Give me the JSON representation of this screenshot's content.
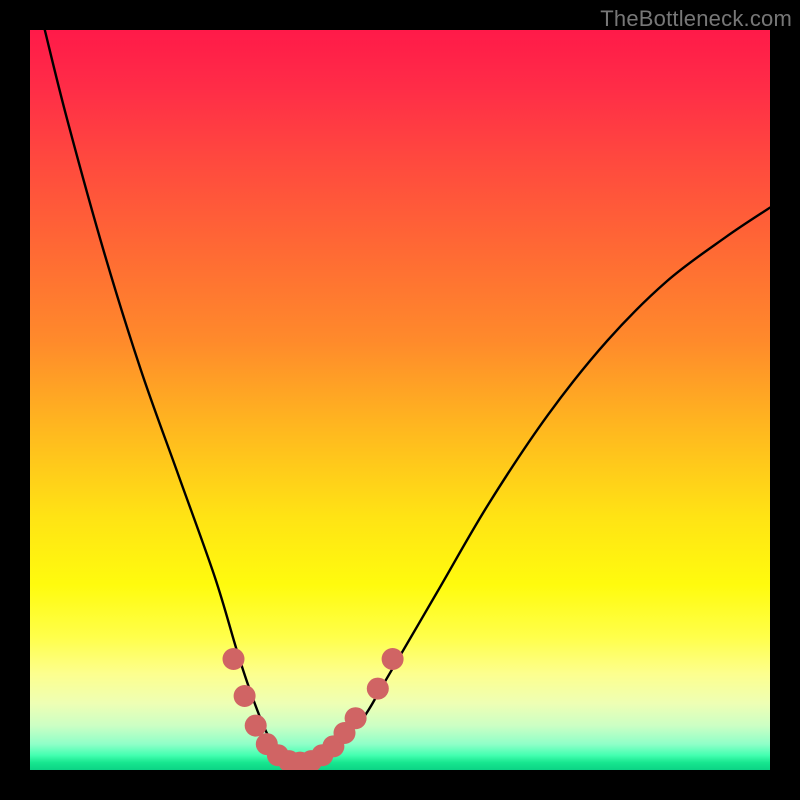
{
  "watermark": "TheBottleneck.com",
  "chart_data": {
    "type": "line",
    "title": "",
    "xlabel": "",
    "ylabel": "",
    "xlim": [
      0,
      100
    ],
    "ylim": [
      0,
      100
    ],
    "series": [
      {
        "name": "bottleneck-curve",
        "x": [
          2,
          5,
          10,
          15,
          20,
          25,
          28,
          30,
          32,
          34,
          36,
          38,
          40,
          42,
          45,
          48,
          55,
          62,
          70,
          78,
          86,
          94,
          100
        ],
        "y": [
          100,
          88,
          70,
          54,
          40,
          26,
          16,
          10,
          5,
          2,
          1,
          1,
          2,
          4,
          7,
          12,
          24,
          36,
          48,
          58,
          66,
          72,
          76
        ]
      }
    ],
    "markers": {
      "name": "highlight-dots",
      "color": "#d06464",
      "x": [
        27.5,
        29,
        30.5,
        32,
        33.5,
        35,
        36.5,
        38,
        39.5,
        41,
        42.5,
        44,
        47,
        49
      ],
      "y": [
        15,
        10,
        6,
        3.5,
        2,
        1.2,
        1,
        1.2,
        2,
        3.2,
        5,
        7,
        11,
        15
      ]
    },
    "gradient_stops": [
      {
        "pos": 0.0,
        "color": "#ff1a49"
      },
      {
        "pos": 0.3,
        "color": "#ff6a34"
      },
      {
        "pos": 0.66,
        "color": "#ffe414"
      },
      {
        "pos": 0.87,
        "color": "#fdff8e"
      },
      {
        "pos": 0.96,
        "color": "#8fffc8"
      },
      {
        "pos": 1.0,
        "color": "#0cd385"
      }
    ]
  }
}
